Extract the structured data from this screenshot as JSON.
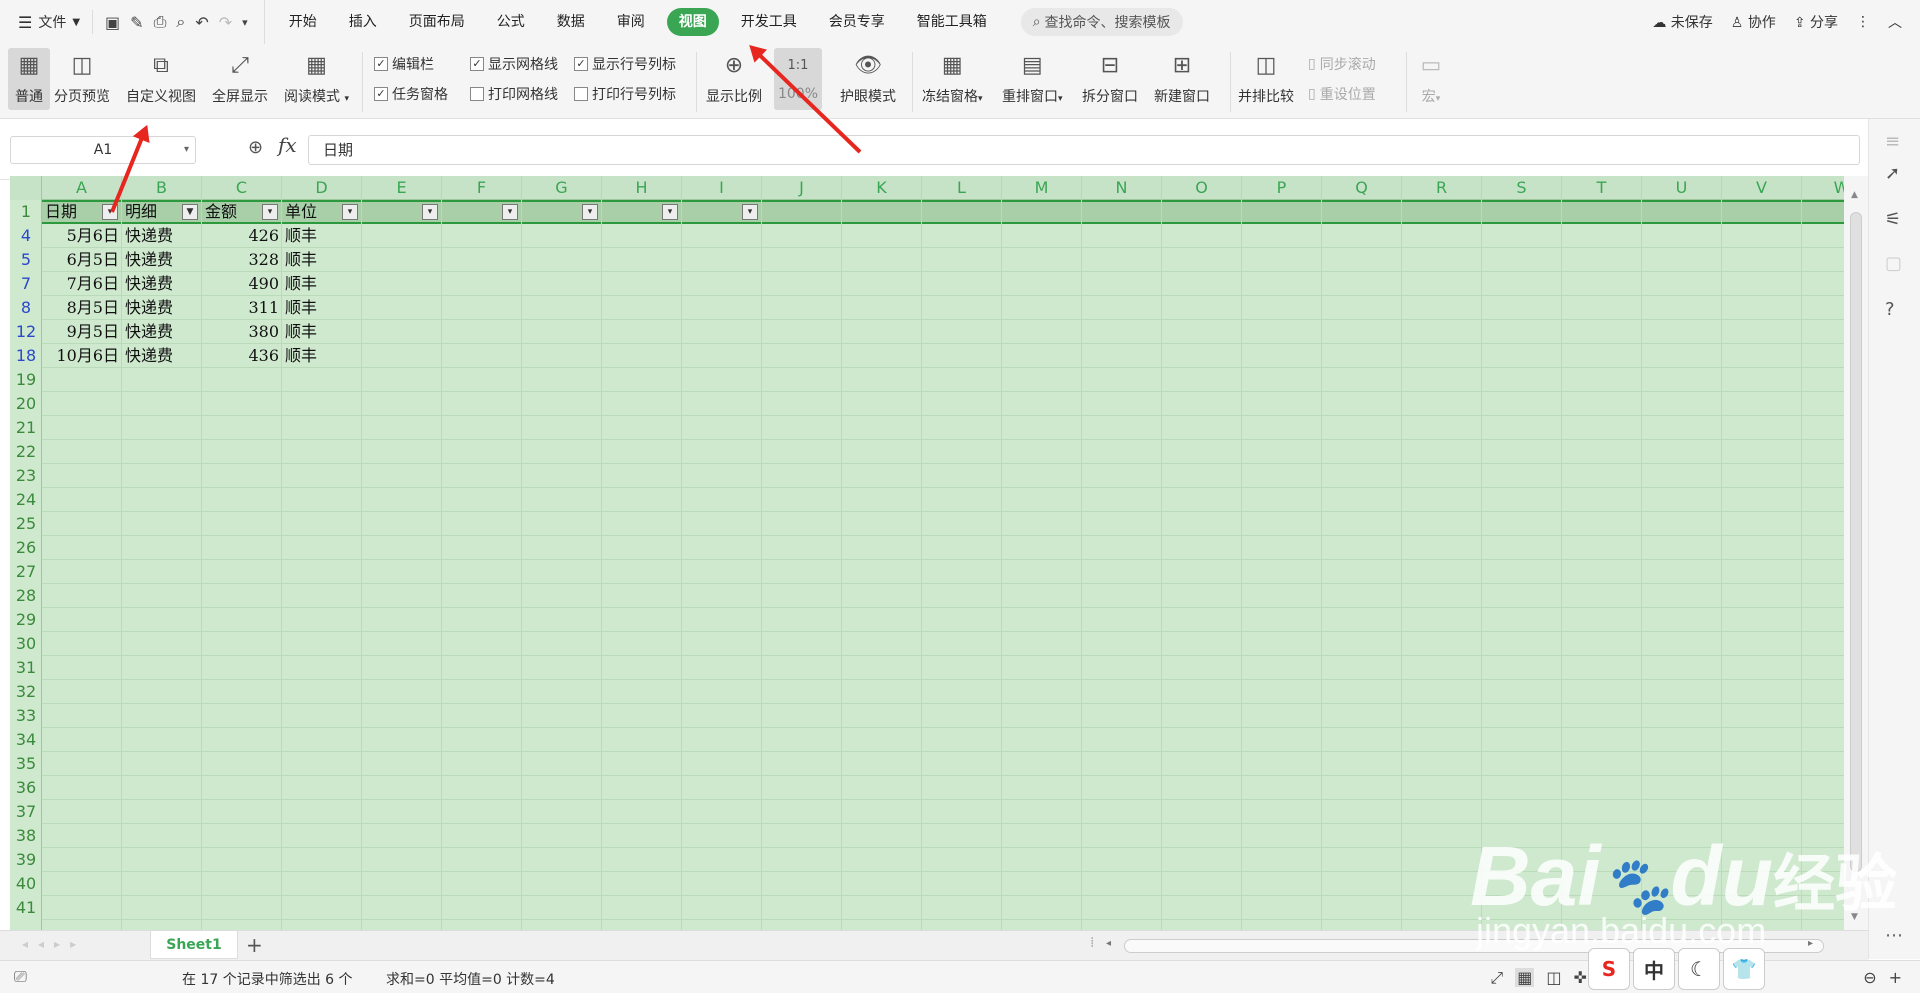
{
  "menubar": {
    "file": "文件",
    "tabs": [
      "开始",
      "插入",
      "页面布局",
      "公式",
      "数据",
      "审阅",
      "视图",
      "开发工具",
      "会员专享",
      "智能工具箱"
    ],
    "active_tab": "视图",
    "search_placeholder": "查找命令、搜索模板",
    "unsaved": "未保存",
    "collab": "协作",
    "share": "分享"
  },
  "ribbon": {
    "normal": "普通",
    "page_preview": "分页预览",
    "custom_view": "自定义视图",
    "fullscreen": "全屏显示",
    "reading_mode": "阅读模式",
    "chk_formula_bar": "编辑栏",
    "chk_task_pane": "任务窗格",
    "chk_show_grid": "显示网格线",
    "chk_print_grid": "打印网格线",
    "chk_show_headers": "显示行号列标",
    "chk_print_headers": "打印行号列标",
    "zoom": "显示比例",
    "zoom100": "100%",
    "zoom_icon_text": "1:1",
    "eye_mode": "护眼模式",
    "freeze": "冻结窗格",
    "arrange": "重排窗口",
    "split": "拆分窗口",
    "new_window": "新建窗口",
    "side_by_side": "并排比较",
    "sync_scroll": "同步滚动",
    "reset_pos": "重设位置",
    "macro": "宏"
  },
  "formula": {
    "cell_ref": "A1",
    "fx": "fx",
    "value": "日期"
  },
  "columns": [
    "A",
    "B",
    "C",
    "D",
    "E",
    "F",
    "G",
    "H",
    "I",
    "J",
    "K",
    "L",
    "M",
    "N",
    "O",
    "P",
    "Q",
    "R",
    "S",
    "T",
    "U",
    "V",
    "W"
  ],
  "header_row": {
    "row": "1",
    "cells": [
      "日期",
      "明细",
      "金额",
      "单位"
    ]
  },
  "rows": [
    {
      "row": "4",
      "date": "5月6日",
      "detail": "快递费",
      "amount": "426",
      "unit": "顺丰"
    },
    {
      "row": "5",
      "date": "6月5日",
      "detail": "快递费",
      "amount": "328",
      "unit": "顺丰"
    },
    {
      "row": "7",
      "date": "7月6日",
      "detail": "快递费",
      "amount": "490",
      "unit": "顺丰"
    },
    {
      "row": "8",
      "date": "8月5日",
      "detail": "快递费",
      "amount": "311",
      "unit": "顺丰"
    },
    {
      "row": "12",
      "date": "9月5日",
      "detail": "快递费",
      "amount": "380",
      "unit": "顺丰"
    },
    {
      "row": "18",
      "date": "10月6日",
      "detail": "快递费",
      "amount": "436",
      "unit": "顺丰"
    }
  ],
  "empty_rows": [
    "19",
    "20",
    "21",
    "22",
    "23",
    "24",
    "25",
    "26",
    "27",
    "28",
    "29",
    "30",
    "31",
    "32",
    "33",
    "34",
    "35",
    "36",
    "37",
    "38",
    "39",
    "40",
    "41"
  ],
  "sheet": {
    "name": "Sheet1",
    "add": "+"
  },
  "status": {
    "filter_info": "在 17 个记录中筛选出 6 个",
    "stats": "求和=0  平均值=0  计数=4"
  },
  "ime": {
    "logo": "S",
    "lang": "中"
  },
  "watermark": {
    "brand": "Bai",
    "brand2": "du",
    "cn": "经验",
    "url": "jingyan.baidu.com"
  }
}
